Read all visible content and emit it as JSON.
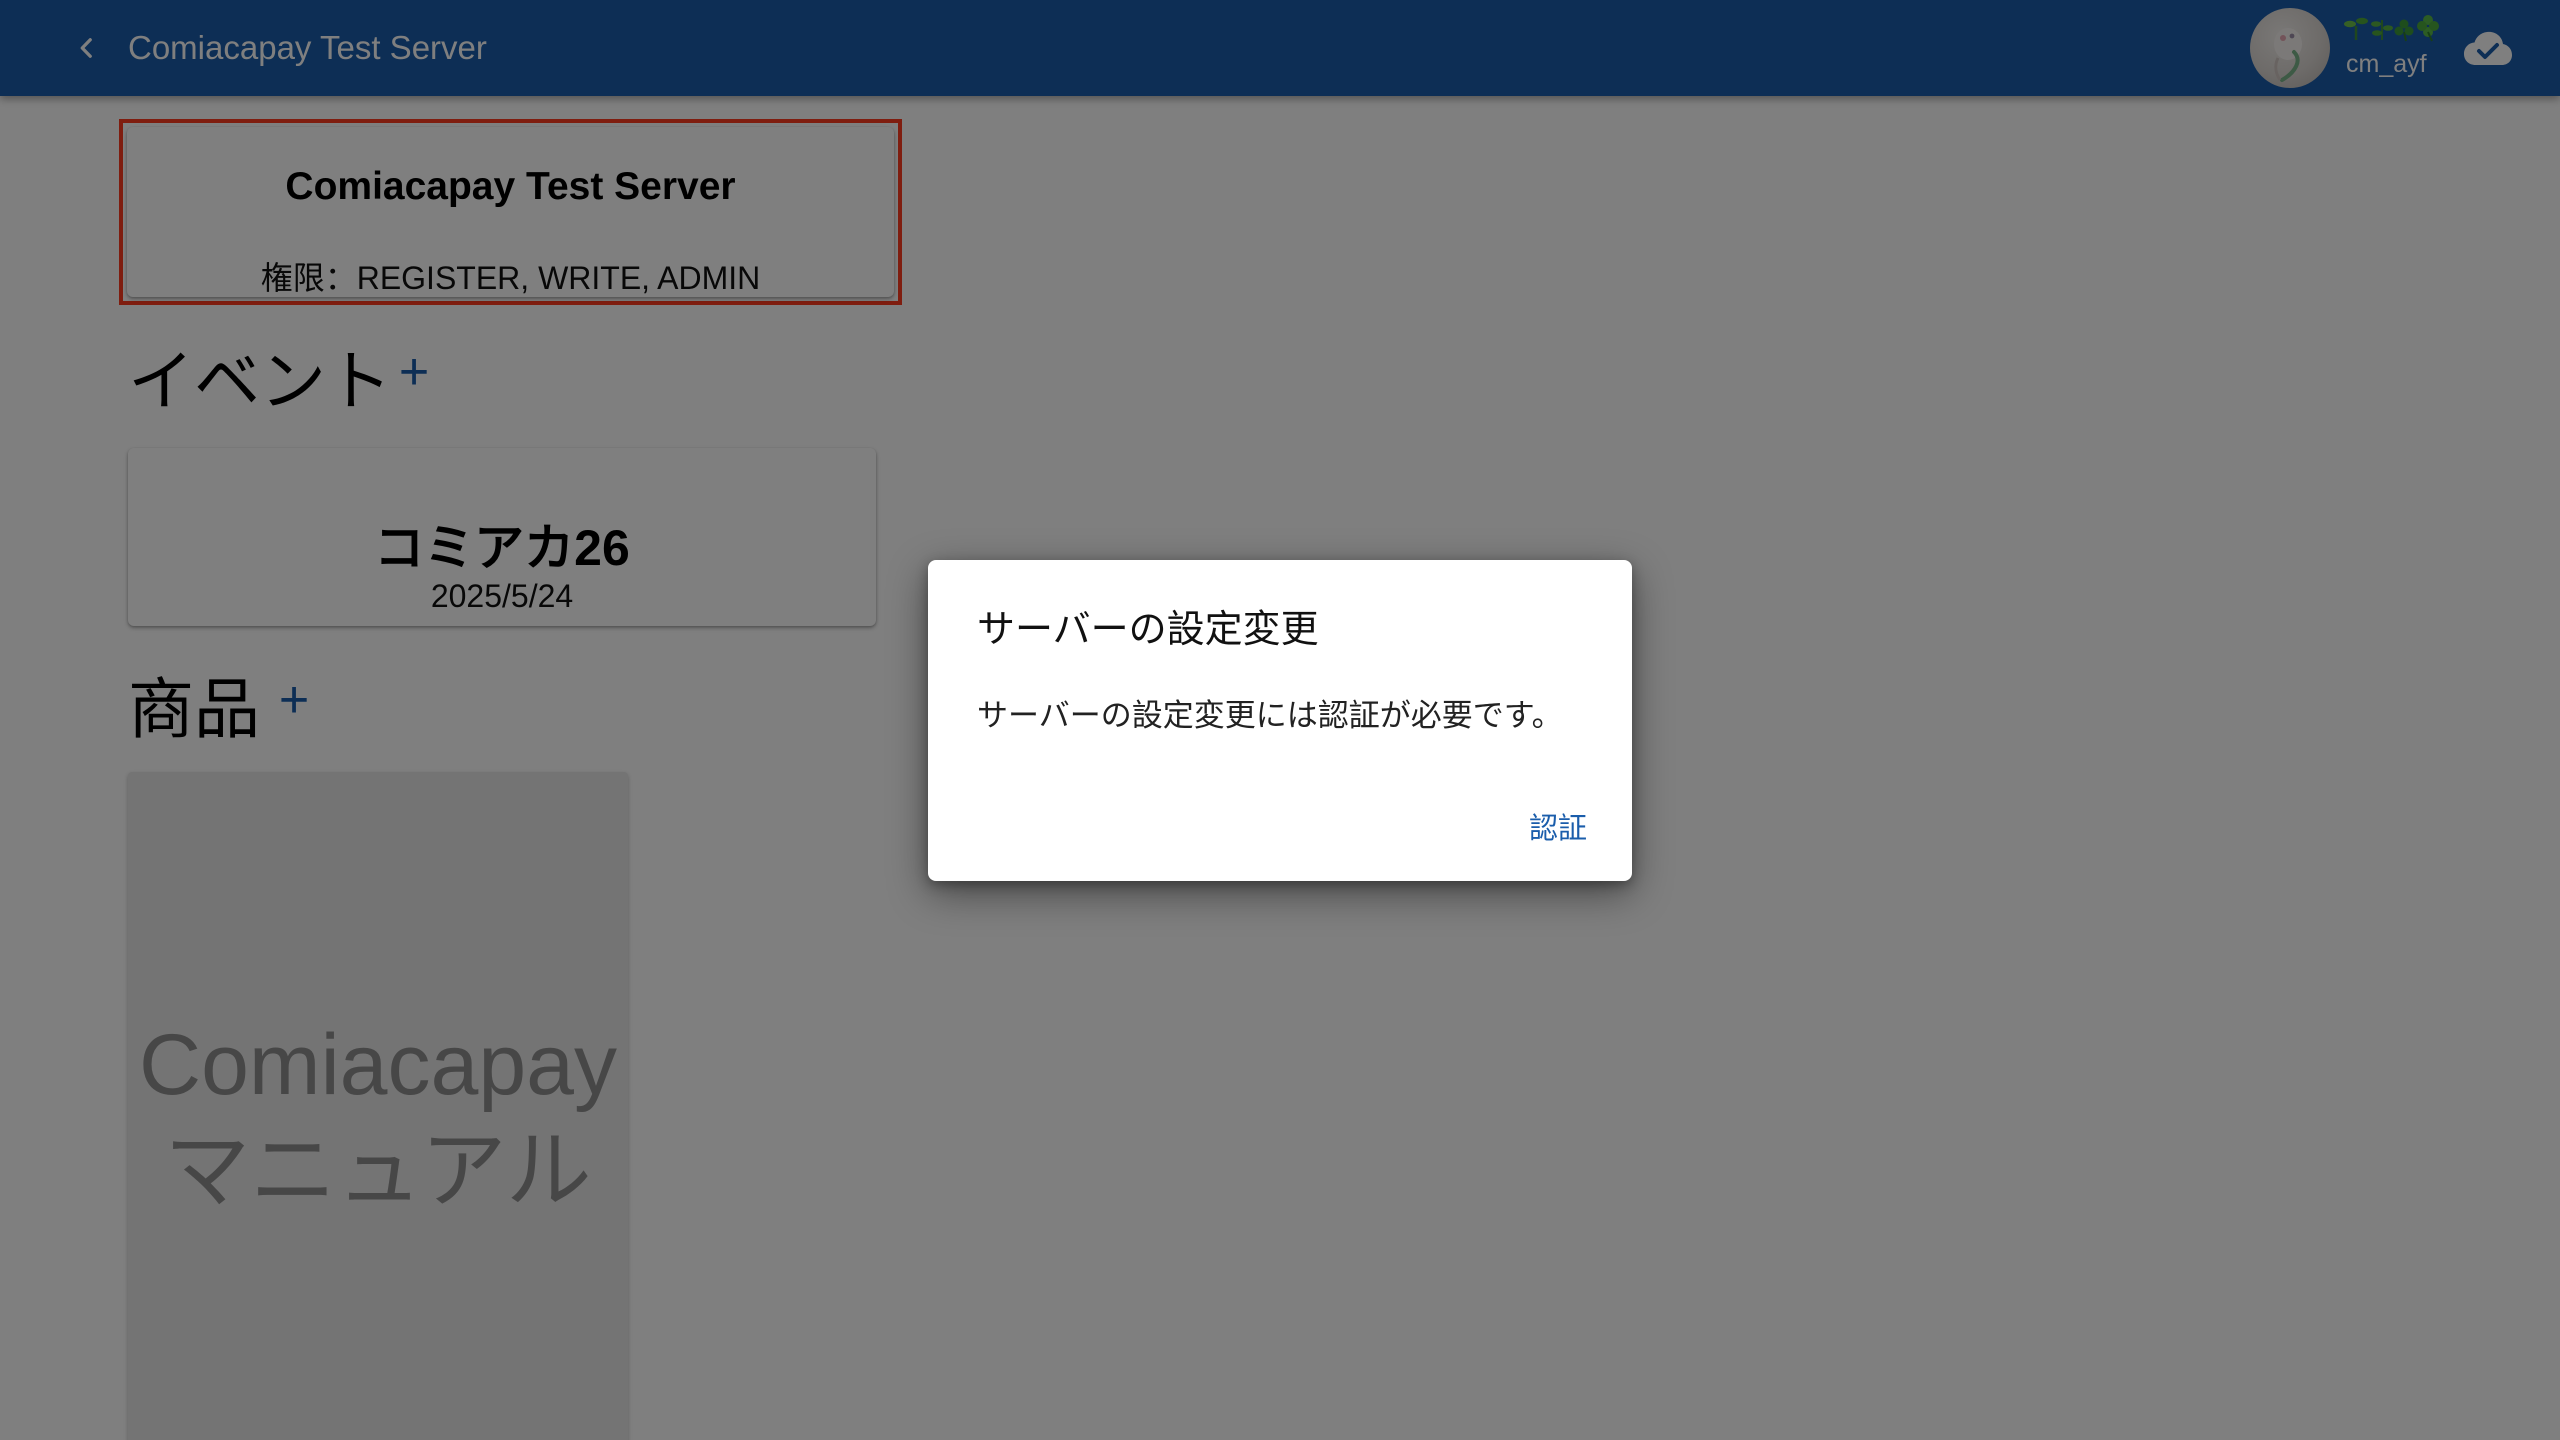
{
  "appbar": {
    "title": "Comiacapay Test Server",
    "user_emoji": "🌱🌿☘️🍀",
    "user_name": "cm_ayf",
    "colors": {
      "background": "#1a5dab",
      "text": "#ffffff"
    },
    "icons": {
      "back": "chevron-left-icon",
      "cloud": "cloud-check-icon"
    }
  },
  "server_card": {
    "title": "Comiacapay Test Server",
    "permissions": "権限：REGISTER, WRITE, ADMIN",
    "highlight_color": "#ff3b1f"
  },
  "events": {
    "section_title": "イベント",
    "add_label": "+",
    "items": [
      {
        "name": "コミアカ26",
        "date": "2025/5/24"
      }
    ]
  },
  "products": {
    "section_title": "商品",
    "add_label": "+",
    "items": [
      {
        "label_line1": "Comiacapay",
        "label_line2": "マニュアル"
      }
    ]
  },
  "dialog": {
    "title": "サーバーの設定変更",
    "message": "サーバーの設定変更には認証が必要です。",
    "action_label": "認証",
    "accent_color": "#1a5dab"
  }
}
